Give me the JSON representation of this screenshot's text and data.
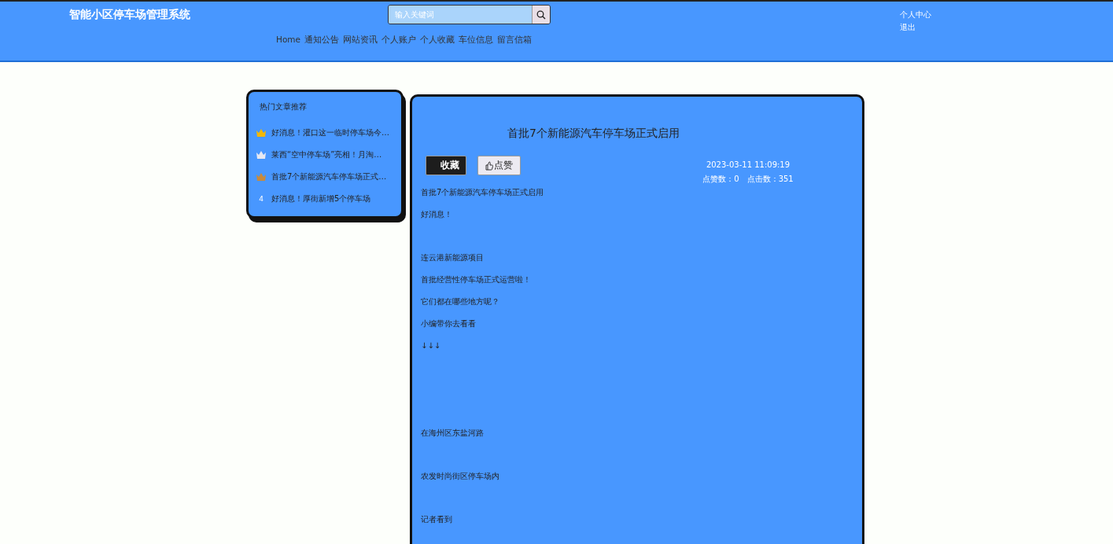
{
  "header": {
    "title": "智能小区停车场管理系统",
    "search": {
      "placeholder": "输入关键词"
    },
    "nav": [
      "Home",
      "通知公告",
      "网站资讯",
      "个人账户",
      "个人收藏",
      "车位信息",
      "留言信箱"
    ],
    "user_links": [
      "个人中心",
      "退出"
    ]
  },
  "hot_articles": {
    "title": "热门文章推荐",
    "items": [
      {
        "kind": "crown",
        "color": "#f5b800",
        "title": "好消息！灌口这一临时停车场今…"
      },
      {
        "kind": "crown",
        "color": "#e6e8f2",
        "title": "莱西“空中停车场”亮相！月淘…"
      },
      {
        "kind": "crown",
        "color": "#c98a3c",
        "title": "首批7个新能源汽车停车场正式…"
      },
      {
        "kind": "number",
        "rank": "4",
        "title": "好消息！厚街新增5个停车场"
      }
    ]
  },
  "article": {
    "title": "首批7个新能源汽车停车场正式启用",
    "buttons": [
      {
        "kind": "dark",
        "label": "收藏"
      },
      {
        "kind": "light",
        "label": "点赞"
      }
    ],
    "date": "2023-03-11 11:09:19",
    "likes_label": "点赞数：",
    "likes": "0",
    "clicks_label": "点击数：",
    "clicks": "351",
    "paragraphs": [
      {
        "kind": "text",
        "text": "首批7个新能源汽车停车场正式启用"
      },
      {
        "kind": "text",
        "text": "好消息！"
      },
      {
        "kind": "after_gap",
        "text": "连云港新能源项目"
      },
      {
        "kind": "text",
        "text": "首批经营性停车场正式运营啦！"
      },
      {
        "kind": "text",
        "text": "它们都在哪些地方呢？"
      },
      {
        "kind": "text",
        "text": "小编带你去看看"
      },
      {
        "kind": "text",
        "text": "↓↓↓"
      },
      {
        "kind": "after_wide_gap",
        "text": "在海州区东盐河路"
      },
      {
        "kind": "after_gap",
        "text": "农发时尚街区停车场内"
      },
      {
        "kind": "after_gap",
        "text": "记者看到"
      }
    ]
  }
}
